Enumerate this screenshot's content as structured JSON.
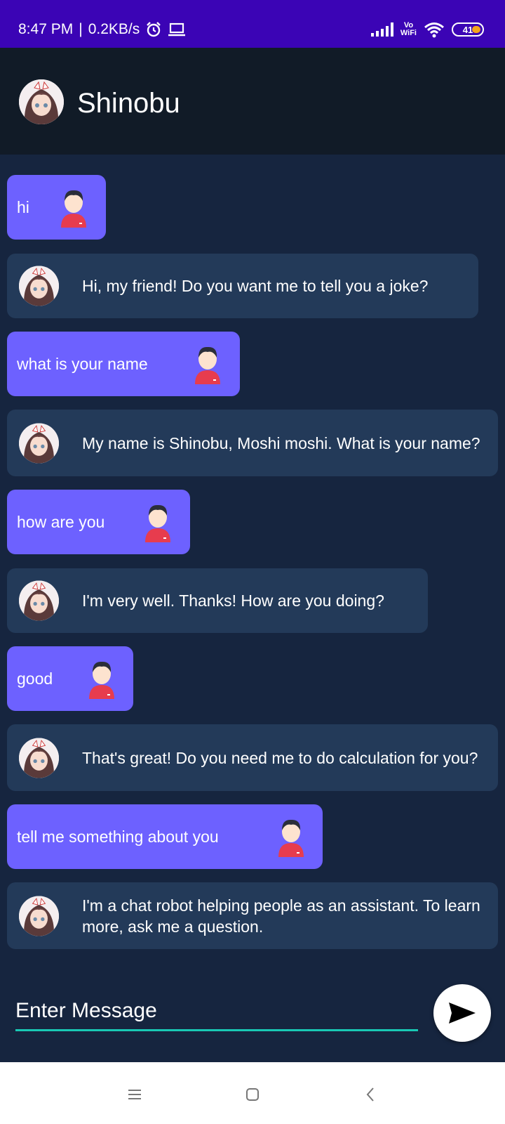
{
  "status_bar": {
    "time": "8:47 PM",
    "speed": "0.2KB/s",
    "vowifi_top": "Vo",
    "vowifi_bottom": "WiFi",
    "battery": "41"
  },
  "header": {
    "title": "Shinobu"
  },
  "messages": [
    {
      "sender": "user",
      "text": "hi"
    },
    {
      "sender": "bot",
      "text": "Hi, my friend! Do you want me to tell you a joke?"
    },
    {
      "sender": "user",
      "text": "what is your name"
    },
    {
      "sender": "bot",
      "text": "My name is Shinobu, Moshi moshi. What is your name?"
    },
    {
      "sender": "user",
      "text": "how are you"
    },
    {
      "sender": "bot",
      "text": "I'm very well. Thanks! How are you doing?"
    },
    {
      "sender": "user",
      "text": "good"
    },
    {
      "sender": "bot",
      "text": "That's great! Do you need me to do calculation for you?"
    },
    {
      "sender": "user",
      "text": "tell me something about you"
    },
    {
      "sender": "bot",
      "text": "I'm a chat robot helping people as an assistant. To learn more, ask me a question."
    }
  ],
  "composer": {
    "placeholder": "Enter Message"
  },
  "icons": {
    "send": "send-icon",
    "menu": "menu-icon",
    "home": "home-icon",
    "back": "back-icon"
  },
  "colors": {
    "status_bar": "#3b04b5",
    "header": "#111b27",
    "background": "#16253f",
    "user_bubble": "#6d61ff",
    "bot_bubble": "#233a59",
    "input_underline": "#19c8b4"
  }
}
